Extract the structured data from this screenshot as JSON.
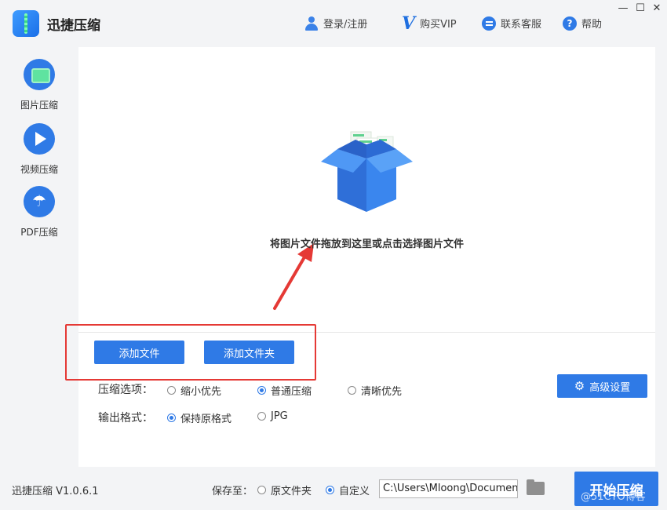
{
  "app": {
    "title": "迅捷压缩"
  },
  "topbar": {
    "login": "登录/注册",
    "vip": "购买VIP",
    "service": "联系客服",
    "help": "帮助",
    "help_glyph": "?",
    "minimize": "—",
    "maximize": "☐",
    "close": "✕"
  },
  "sidebar": {
    "items": [
      {
        "label": "图片压缩",
        "icon": "picture-icon"
      },
      {
        "label": "视频压缩",
        "icon": "play-icon"
      },
      {
        "label": "PDF压缩",
        "icon": "pdf-icon"
      }
    ]
  },
  "drop": {
    "text": "将图片文件拖放到这里或点击选择图片文件"
  },
  "buttons": {
    "add_file": "添加文件",
    "add_folder": "添加文件夹",
    "advanced": "高级设置",
    "start": "开始压缩"
  },
  "compress_options": {
    "label": "压缩选项：",
    "options": [
      "缩小优先",
      "普通压缩",
      "清晰优先"
    ],
    "selected": "普通压缩"
  },
  "output_format": {
    "label": "输出格式：",
    "options": [
      "保持原格式",
      "JPG"
    ],
    "selected": "保持原格式"
  },
  "footer": {
    "version": "迅捷压缩 V1.0.6.1",
    "save_to": "保存至：",
    "save_options": [
      "原文件夹",
      "自定义"
    ],
    "save_selected": "自定义",
    "path": "C:\\Users\\Mloong\\Documents"
  },
  "watermark": "@51CTO博客",
  "colors": {
    "accent": "#2f7ae6",
    "highlight": "#e53935",
    "background": "#f3f4f6"
  }
}
